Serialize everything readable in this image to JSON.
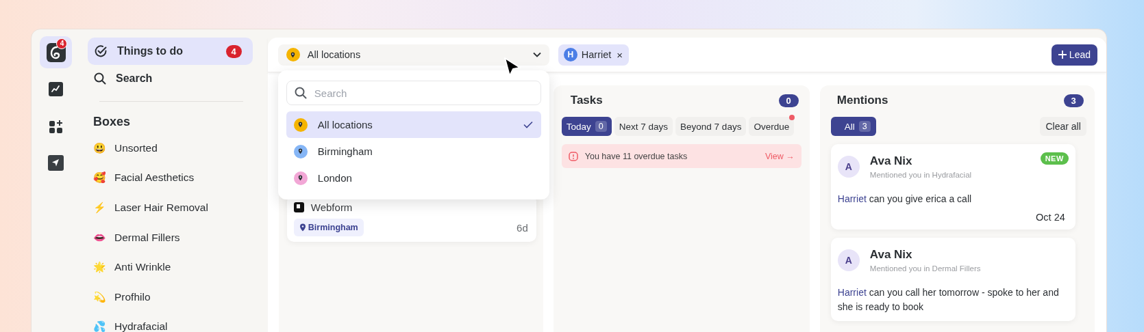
{
  "rail": {
    "logo_badge": "4",
    "items": [
      {
        "kind": "logo",
        "selected": true
      },
      {
        "kind": "chart",
        "selected": false
      },
      {
        "kind": "apps",
        "selected": false
      },
      {
        "kind": "send",
        "selected": false
      }
    ]
  },
  "sidebar": {
    "nav": [
      {
        "kind": "todo",
        "label": "Things to do",
        "badge": "4",
        "selected": true
      },
      {
        "kind": "search",
        "label": "Search",
        "selected": false
      }
    ],
    "section_title": "Boxes",
    "boxes": [
      {
        "emoji": "😃",
        "label": "Unsorted"
      },
      {
        "emoji": "🥰",
        "label": "Facial Aesthetics"
      },
      {
        "emoji": "⚡",
        "label": "Laser Hair Removal"
      },
      {
        "emoji": "👄",
        "label": "Dermal Fillers"
      },
      {
        "emoji": "🌟",
        "label": "Anti Wrinkle"
      },
      {
        "emoji": "💫",
        "label": "Profhilo"
      },
      {
        "emoji": "💦",
        "label": "Hydrafacial"
      }
    ]
  },
  "location_select": {
    "value": "All locations",
    "color": "#f5b400",
    "expanded": true
  },
  "dropdown": {
    "placeholder": "Search",
    "options": [
      {
        "label": "All locations",
        "color": "#f5b400",
        "selected": true
      },
      {
        "label": "Birmingham",
        "color": "#86b6f6",
        "selected": false
      },
      {
        "label": "London",
        "color": "#f2a7d6",
        "selected": false
      }
    ]
  },
  "filter_chip": {
    "initial": "H",
    "label": "Harriet",
    "remove": "×"
  },
  "lead_button": {
    "label": "Lead"
  },
  "lead_card": {
    "source": "Webform",
    "location": "Birmingham",
    "age": "6d"
  },
  "tasks": {
    "title": "Tasks",
    "count": "0",
    "tabs": [
      {
        "label": "Today",
        "count": "0",
        "selected": true,
        "alert": false
      },
      {
        "label": "Next 7 days",
        "selected": false,
        "alert": false
      },
      {
        "label": "Beyond 7 days",
        "selected": false,
        "alert": false
      },
      {
        "label": "Overdue",
        "selected": false,
        "alert": true
      }
    ],
    "notice": {
      "text": "You have 11 overdue tasks",
      "action": "View →"
    }
  },
  "mentions": {
    "title": "Mentions",
    "count": "3",
    "filters": [
      {
        "label": "All",
        "count": "3",
        "selected": true
      }
    ],
    "clear": "Clear all",
    "items": [
      {
        "initial": "A",
        "name": "Ava Nix",
        "context": "Mentioned you in Hydrafacial",
        "badge": "NEW",
        "mention": "Harriet",
        "text": "can  you  give erica a call",
        "date": "Oct 24"
      },
      {
        "initial": "A",
        "name": "Ava Nix",
        "context": "Mentioned you in Dermal Fillers",
        "mention": "Harriet",
        "text": "can you call her tomorrow - spoke to her and she is ready to book"
      }
    ]
  }
}
